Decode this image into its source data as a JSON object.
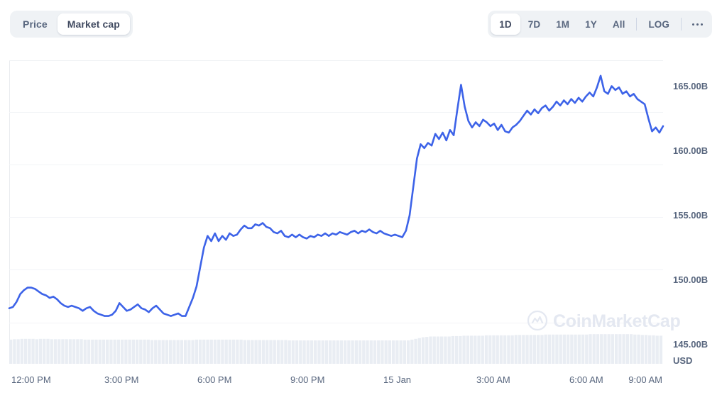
{
  "toolbar": {
    "metric_toggle": {
      "name": "metric-toggle",
      "options": [
        {
          "id": "price",
          "label": "Price",
          "active": false
        },
        {
          "id": "market-cap",
          "label": "Market cap",
          "active": true
        }
      ]
    },
    "range_toggle": {
      "name": "time-range-toggle",
      "options": [
        {
          "id": "1d",
          "label": "1D",
          "active": true
        },
        {
          "id": "7d",
          "label": "7D",
          "active": false
        },
        {
          "id": "1m",
          "label": "1M",
          "active": false
        },
        {
          "id": "1y",
          "label": "1Y",
          "active": false
        },
        {
          "id": "all",
          "label": "All",
          "active": false
        }
      ],
      "log_label": "LOG",
      "more_label": "..."
    }
  },
  "watermark": {
    "text": "CoinMarketCap"
  },
  "colors": {
    "line": "#3D63E8",
    "grid": "#F0F2F5",
    "axis": "#EAECEF",
    "volume": "#E9EDF3",
    "text": "#58667E",
    "toggle_bg": "#EFF2F5",
    "watermark": "#E4E8F1"
  },
  "chart_data": {
    "type": "line",
    "title": "",
    "xlabel": "",
    "ylabel": "USD",
    "unit": "USD",
    "currency": "USD",
    "value_suffix": "B",
    "ylim": [
      143.5,
      167.0
    ],
    "grid": true,
    "legend": "none",
    "y_ticks": [
      165,
      160,
      155,
      150,
      145
    ],
    "y_tick_labels": [
      "165.00B",
      "160.00B",
      "155.00B",
      "150.00B",
      "145.00B"
    ],
    "x_ticks": [
      0,
      3,
      6,
      9,
      12,
      15,
      18,
      21
    ],
    "x_tick_labels": [
      "12:00 PM",
      "3:00 PM",
      "6:00 PM",
      "9:00 PM",
      "15 Jan",
      "3:00 AM",
      "6:00 AM",
      "9:00 AM"
    ],
    "series": [
      {
        "name": "Market cap",
        "color": "#3D63E8",
        "x": [
          0.0,
          0.13,
          0.26,
          0.39,
          0.52,
          0.65,
          0.78,
          0.91,
          1.04,
          1.17,
          1.3,
          1.43,
          1.56,
          1.69,
          1.82,
          1.95,
          2.08,
          2.21,
          2.34,
          2.47,
          2.6,
          2.73,
          2.86,
          2.99,
          3.12,
          3.25,
          3.38,
          3.51,
          3.64,
          3.77,
          3.9,
          4.03,
          4.16,
          4.29,
          4.42,
          4.55,
          4.68,
          4.81,
          4.94,
          5.07,
          5.2,
          5.33,
          5.46,
          5.59,
          5.72,
          5.85,
          5.98,
          6.11,
          6.24,
          6.37,
          6.5,
          6.63,
          6.76,
          6.89,
          7.02,
          7.15,
          7.28,
          7.41,
          7.54,
          7.67,
          7.8,
          7.93,
          8.06,
          8.19,
          8.32,
          8.45,
          8.58,
          8.71,
          8.84,
          8.97,
          9.1,
          9.23,
          9.36,
          9.49,
          9.62,
          9.75,
          9.88,
          10.01,
          10.14,
          10.27,
          10.4,
          10.53,
          10.66,
          10.79,
          10.92,
          11.05,
          11.18,
          11.31,
          11.44,
          11.57,
          11.7,
          11.83,
          11.96,
          12.09,
          12.22,
          12.35,
          12.48,
          12.61,
          12.74,
          12.87,
          13.0,
          13.13,
          13.26,
          13.39,
          13.52,
          13.65,
          13.78,
          13.91,
          14.04,
          14.17,
          14.3,
          14.43,
          14.56,
          14.69,
          14.82,
          14.95,
          15.08,
          15.21,
          15.34,
          15.47,
          15.6,
          15.73,
          15.86,
          15.99,
          16.12,
          16.25,
          16.38,
          16.51,
          16.64,
          16.77,
          16.9,
          17.03,
          17.16,
          17.29,
          17.42,
          17.55,
          17.68,
          17.81,
          17.94,
          18.07,
          18.2,
          18.33,
          18.46,
          18.59,
          18.72,
          18.85,
          18.98,
          19.11,
          19.24,
          19.37,
          19.5,
          19.63,
          19.76,
          19.89,
          20.02,
          20.15,
          20.28,
          20.41,
          20.54,
          20.67,
          20.8,
          20.93,
          21.06,
          21.19,
          21.32,
          21.45,
          21.58,
          21.71,
          21.84,
          21.97,
          22.1,
          22.23,
          22.36,
          22.49,
          22.62,
          22.75,
          22.88,
          23.01
        ],
        "values": [
          147.8,
          147.9,
          148.3,
          148.9,
          149.2,
          149.4,
          149.4,
          149.3,
          149.1,
          148.9,
          148.8,
          148.6,
          148.7,
          148.5,
          148.2,
          148.0,
          147.9,
          148.0,
          147.9,
          147.8,
          147.6,
          147.8,
          147.9,
          147.6,
          147.4,
          147.3,
          147.2,
          147.2,
          147.3,
          147.6,
          148.2,
          147.9,
          147.6,
          147.7,
          147.9,
          148.1,
          147.8,
          147.7,
          147.5,
          147.8,
          148.0,
          147.7,
          147.4,
          147.3,
          147.2,
          147.3,
          147.4,
          147.2,
          147.2,
          147.9,
          148.6,
          149.5,
          151.0,
          152.5,
          153.4,
          153.0,
          153.6,
          153.0,
          153.4,
          153.1,
          153.6,
          153.4,
          153.5,
          153.9,
          154.2,
          154.0,
          154.0,
          154.3,
          154.2,
          154.4,
          154.1,
          154.0,
          153.7,
          153.6,
          153.8,
          153.4,
          153.3,
          153.5,
          153.3,
          153.5,
          153.3,
          153.2,
          153.4,
          153.3,
          153.5,
          153.4,
          153.6,
          153.4,
          153.6,
          153.5,
          153.7,
          153.6,
          153.5,
          153.7,
          153.8,
          153.6,
          153.8,
          153.7,
          153.9,
          153.7,
          153.6,
          153.8,
          153.6,
          153.5,
          153.4,
          153.5,
          153.4,
          153.3,
          153.8,
          155.0,
          157.2,
          159.4,
          160.5,
          160.2,
          160.6,
          160.4,
          161.3,
          160.9,
          161.4,
          160.8,
          161.6,
          161.2,
          163.2,
          165.1,
          163.4,
          162.3,
          161.8,
          162.2,
          161.9,
          162.4,
          162.2,
          161.9,
          162.1,
          161.6,
          162.0,
          161.5,
          161.4,
          161.8,
          162.0,
          162.3,
          162.7,
          163.1,
          162.8,
          163.2,
          162.9,
          163.3,
          163.5,
          163.1,
          163.4,
          163.8,
          163.5,
          163.9,
          163.6,
          164.0,
          163.7,
          164.1,
          163.8,
          164.2,
          164.5,
          164.2,
          164.9,
          165.8,
          164.6,
          164.4,
          165.0,
          164.7,
          164.9,
          164.4,
          164.6,
          164.2,
          164.4,
          164.0,
          163.8,
          163.6,
          162.5,
          161.5,
          161.8,
          161.4,
          161.9
        ]
      }
    ],
    "volume_series": {
      "name": "Volume",
      "color": "#E9EDF3",
      "values": [
        0.62,
        0.63,
        0.63,
        0.64,
        0.64,
        0.64,
        0.64,
        0.63,
        0.64,
        0.64,
        0.64,
        0.63,
        0.63,
        0.63,
        0.63,
        0.63,
        0.63,
        0.63,
        0.63,
        0.63,
        0.62,
        0.62,
        0.62,
        0.62,
        0.62,
        0.62,
        0.62,
        0.62,
        0.62,
        0.62,
        0.62,
        0.62,
        0.62,
        0.62,
        0.62,
        0.62,
        0.62,
        0.62,
        0.61,
        0.61,
        0.61,
        0.61,
        0.61,
        0.61,
        0.61,
        0.61,
        0.61,
        0.61,
        0.61,
        0.61,
        0.62,
        0.62,
        0.62,
        0.62,
        0.62,
        0.62,
        0.62,
        0.62,
        0.62,
        0.62,
        0.62,
        0.62,
        0.62,
        0.61,
        0.61,
        0.61,
        0.61,
        0.61,
        0.61,
        0.61,
        0.61,
        0.61,
        0.61,
        0.61,
        0.61,
        0.6,
        0.6,
        0.6,
        0.6,
        0.6,
        0.6,
        0.6,
        0.6,
        0.6,
        0.6,
        0.6,
        0.6,
        0.6,
        0.6,
        0.6,
        0.6,
        0.6,
        0.6,
        0.6,
        0.6,
        0.6,
        0.6,
        0.6,
        0.6,
        0.6,
        0.6,
        0.6,
        0.6,
        0.6,
        0.6,
        0.6,
        0.6,
        0.6,
        0.62,
        0.64,
        0.66,
        0.68,
        0.69,
        0.7,
        0.7,
        0.7,
        0.7,
        0.7,
        0.7,
        0.71,
        0.71,
        0.71,
        0.72,
        0.72,
        0.72,
        0.72,
        0.72,
        0.72,
        0.73,
        0.73,
        0.73,
        0.73,
        0.73,
        0.73,
        0.73,
        0.73,
        0.74,
        0.74,
        0.74,
        0.74,
        0.74,
        0.74,
        0.74,
        0.74,
        0.75,
        0.75,
        0.75,
        0.75,
        0.75,
        0.75,
        0.75,
        0.75,
        0.75,
        0.75,
        0.75,
        0.75,
        0.76,
        0.76,
        0.76,
        0.76,
        0.76,
        0.76,
        0.76,
        0.76,
        0.76,
        0.76,
        0.76,
        0.76,
        0.75,
        0.75,
        0.74,
        0.74,
        0.73,
        0.73,
        0.72,
        0.72
      ]
    }
  }
}
